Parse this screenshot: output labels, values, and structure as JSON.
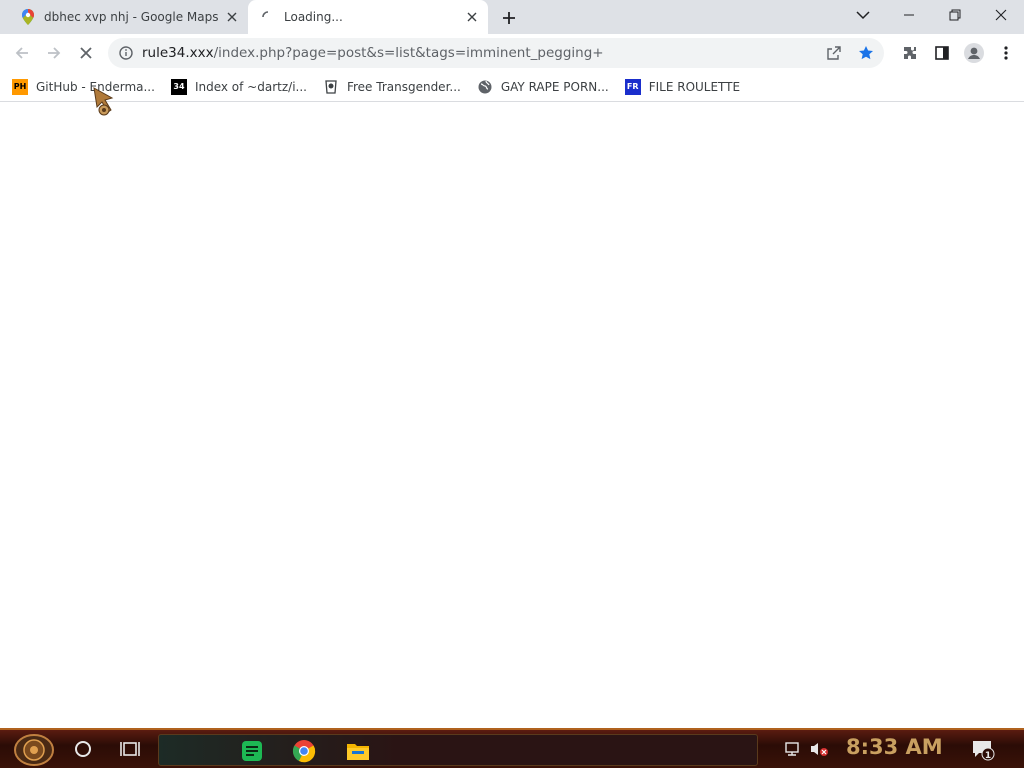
{
  "tabs": [
    {
      "title": "dbhec xvp nhj - Google Maps",
      "favicon": "google-maps-pin-icon",
      "active": false
    },
    {
      "title": "Loading...",
      "favicon": "loading-spinner-icon",
      "active": true
    }
  ],
  "omnibox": {
    "host": "rule34.xxx",
    "path": "/index.php?page=post&s=list&tags=imminent_pegging+"
  },
  "bookmarks": [
    {
      "label": "GitHub - Enderma...",
      "icon": "ph-icon",
      "icon_text": "PH"
    },
    {
      "label": "Index of ~dartz/i...",
      "icon": "index-icon",
      "icon_text": "34"
    },
    {
      "label": "Free Transgender...",
      "icon": "site-icon"
    },
    {
      "label": "GAY RAPE PORN...",
      "icon": "globe-icon"
    },
    {
      "label": "FILE ROULETTE",
      "icon": "file-roulette-icon",
      "icon_text": "FR"
    }
  ],
  "taskbar": {
    "clock": "8:33 AM",
    "notification_count": "1"
  },
  "colors": {
    "accent_star": "#1a73e8",
    "clock": "#c9a060",
    "taskbar_border": "#b0621e"
  }
}
